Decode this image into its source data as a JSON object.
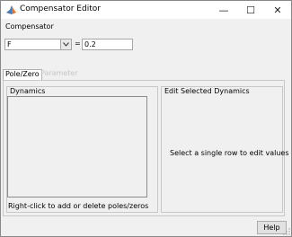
{
  "window": {
    "title": "Compensator Editor",
    "icon": "matlab-icon",
    "controls": {
      "minimize": "—",
      "maximize": "☐",
      "close": "✕"
    }
  },
  "compensator": {
    "label": "Compensator",
    "select_value": "F",
    "equals": "=",
    "expression_value": "0.2"
  },
  "tabs": [
    {
      "label": "Pole/Zero",
      "active": true
    },
    {
      "label": "Parameter",
      "active": false
    }
  ],
  "dynamics": {
    "label": "Dynamics",
    "hint": "Right-click to add or delete poles/zeros"
  },
  "edit_dynamics": {
    "label": "Edit Selected Dynamics",
    "message": "Select a single row to edit values"
  },
  "footer": {
    "help_label": "Help"
  }
}
